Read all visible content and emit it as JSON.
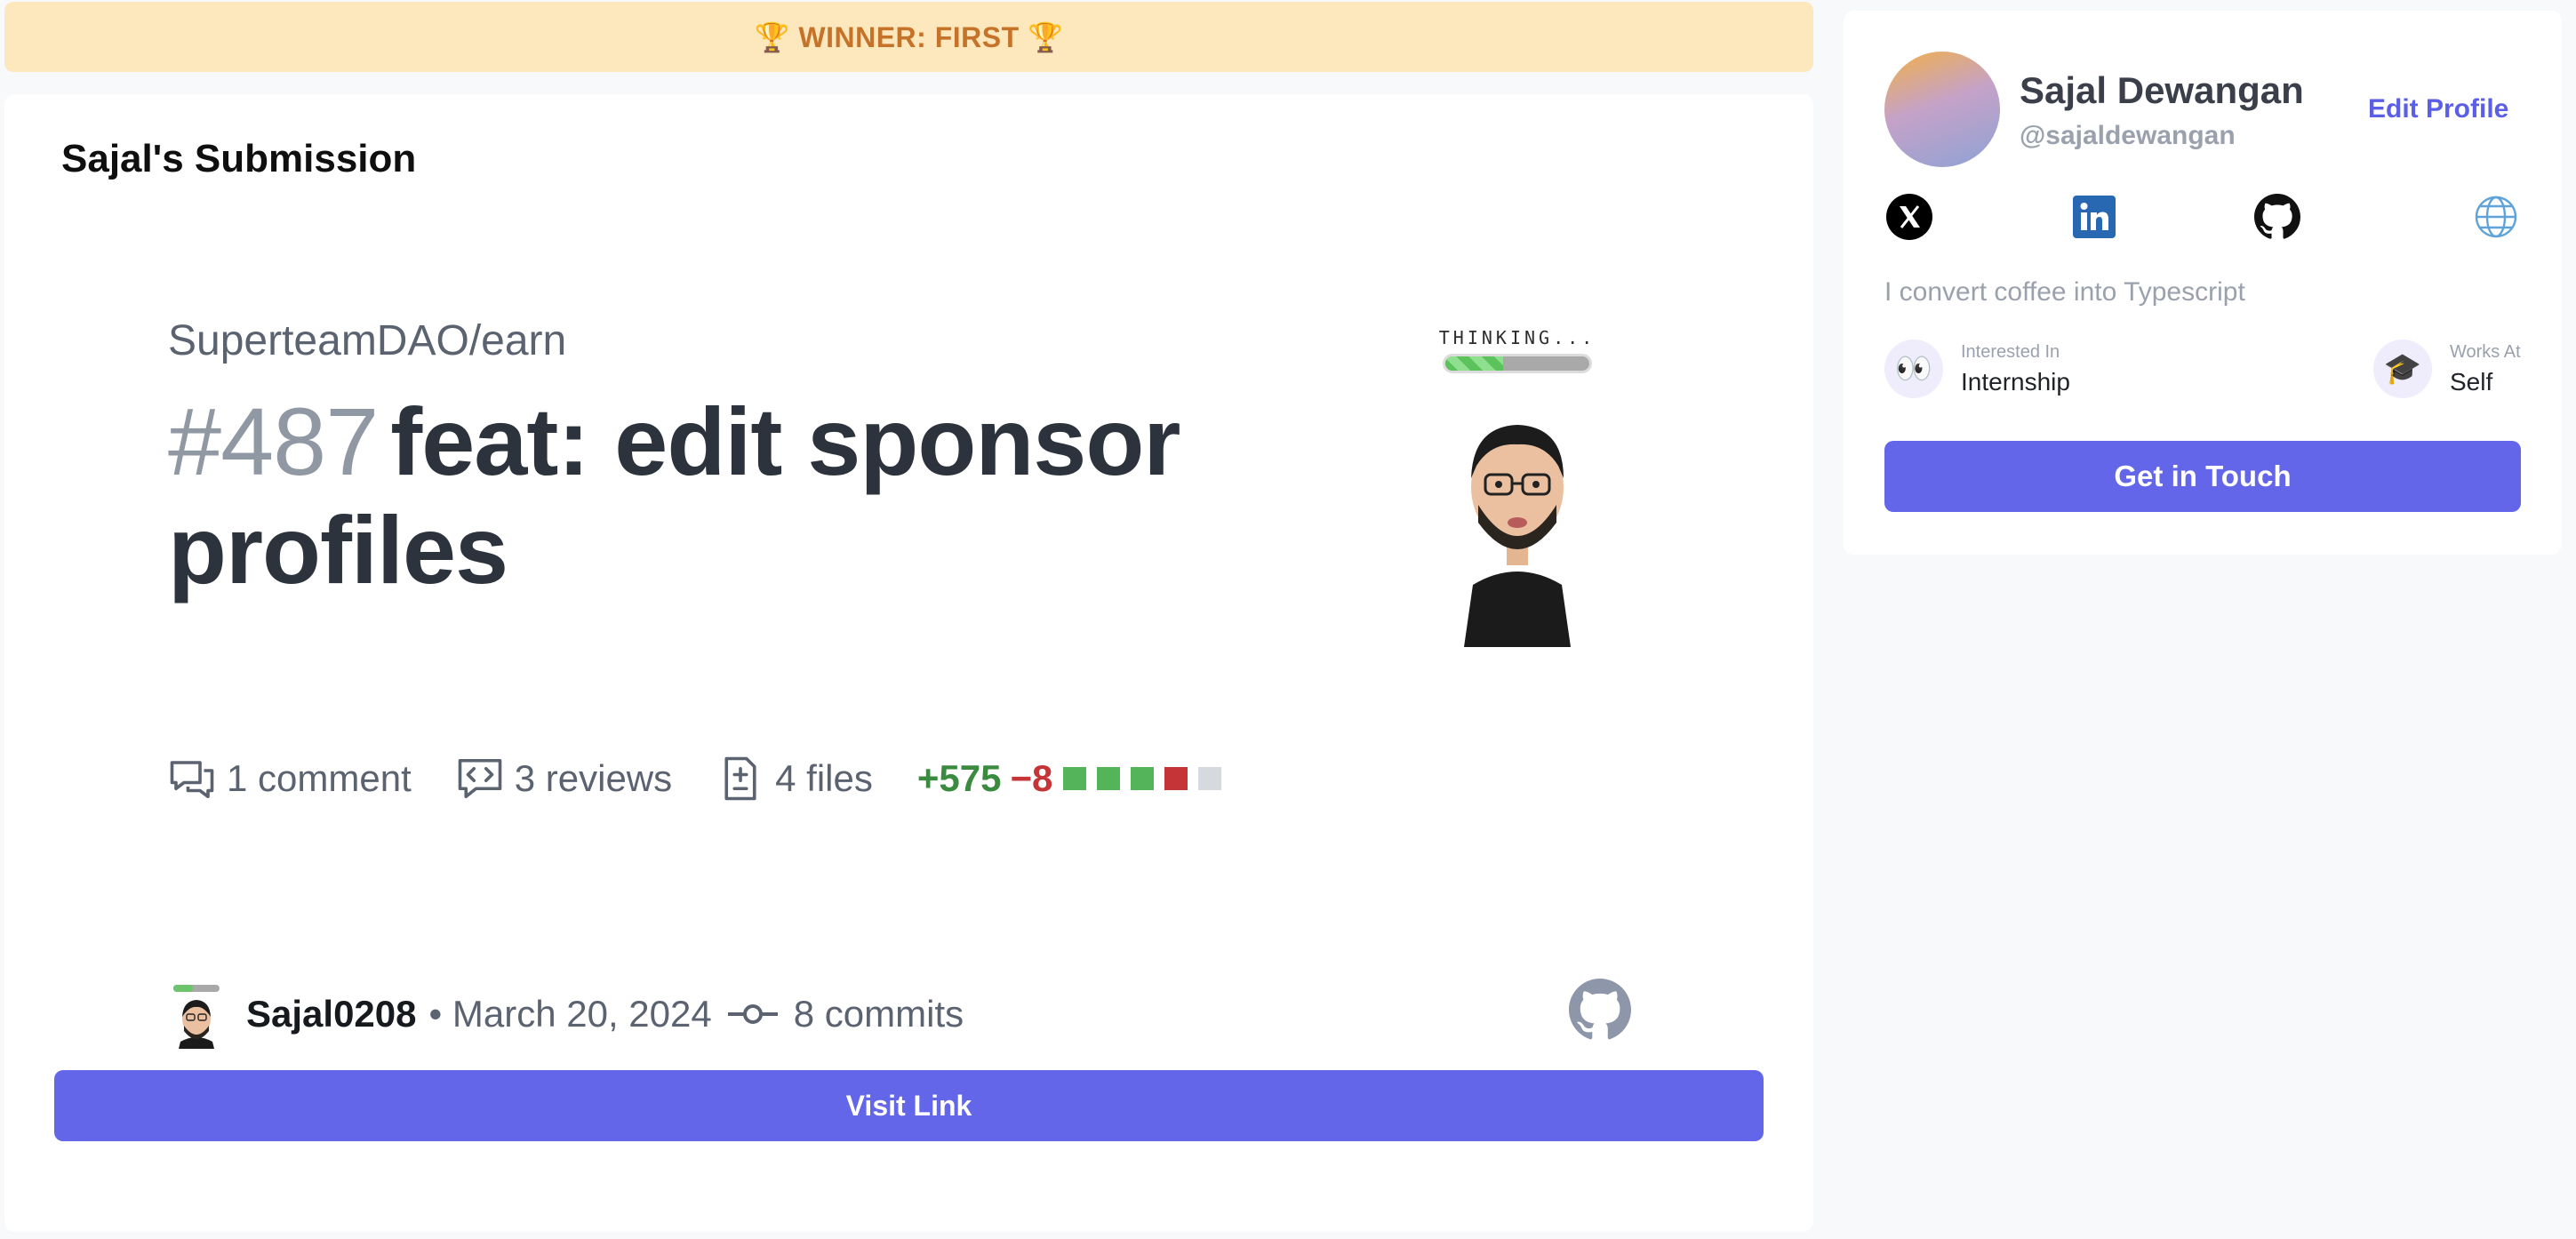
{
  "banner": {
    "text": "🏆 WINNER: FIRST 🏆",
    "color": "#c6732a",
    "background": "#fde8bd"
  },
  "submission": {
    "title": "Sajal's Submission",
    "pr": {
      "repo": "SuperteamDAO/earn",
      "number": "#487",
      "title": "feat: edit sponsor profiles",
      "comments": "1 comment",
      "reviews": "3 reviews",
      "files": "4 files",
      "additions": "+575",
      "deletions": "−8",
      "diff_squares": [
        "green",
        "green",
        "green",
        "red",
        "gray"
      ],
      "mascot_text": "THINKING...",
      "mascot_progress": 0.4,
      "author": "Sajal0208",
      "date": "• March 20, 2024",
      "commits": "8 commits"
    },
    "visit_label": "Visit Link"
  },
  "profile": {
    "name": "Sajal Dewangan",
    "handle": "@sajaldewangan",
    "edit_label": "Edit Profile",
    "socials": [
      "x-icon",
      "linkedin-icon",
      "github-icon",
      "globe-icon"
    ],
    "bio": "I convert coffee into Typescript",
    "interested_label": "Interested In",
    "interested_value": "Internship",
    "works_label": "Works At",
    "works_value": "Self",
    "touch_label": "Get in Touch"
  },
  "colors": {
    "accent": "#6366e9",
    "additions": "#3a8a3f",
    "deletions": "#c53436"
  }
}
